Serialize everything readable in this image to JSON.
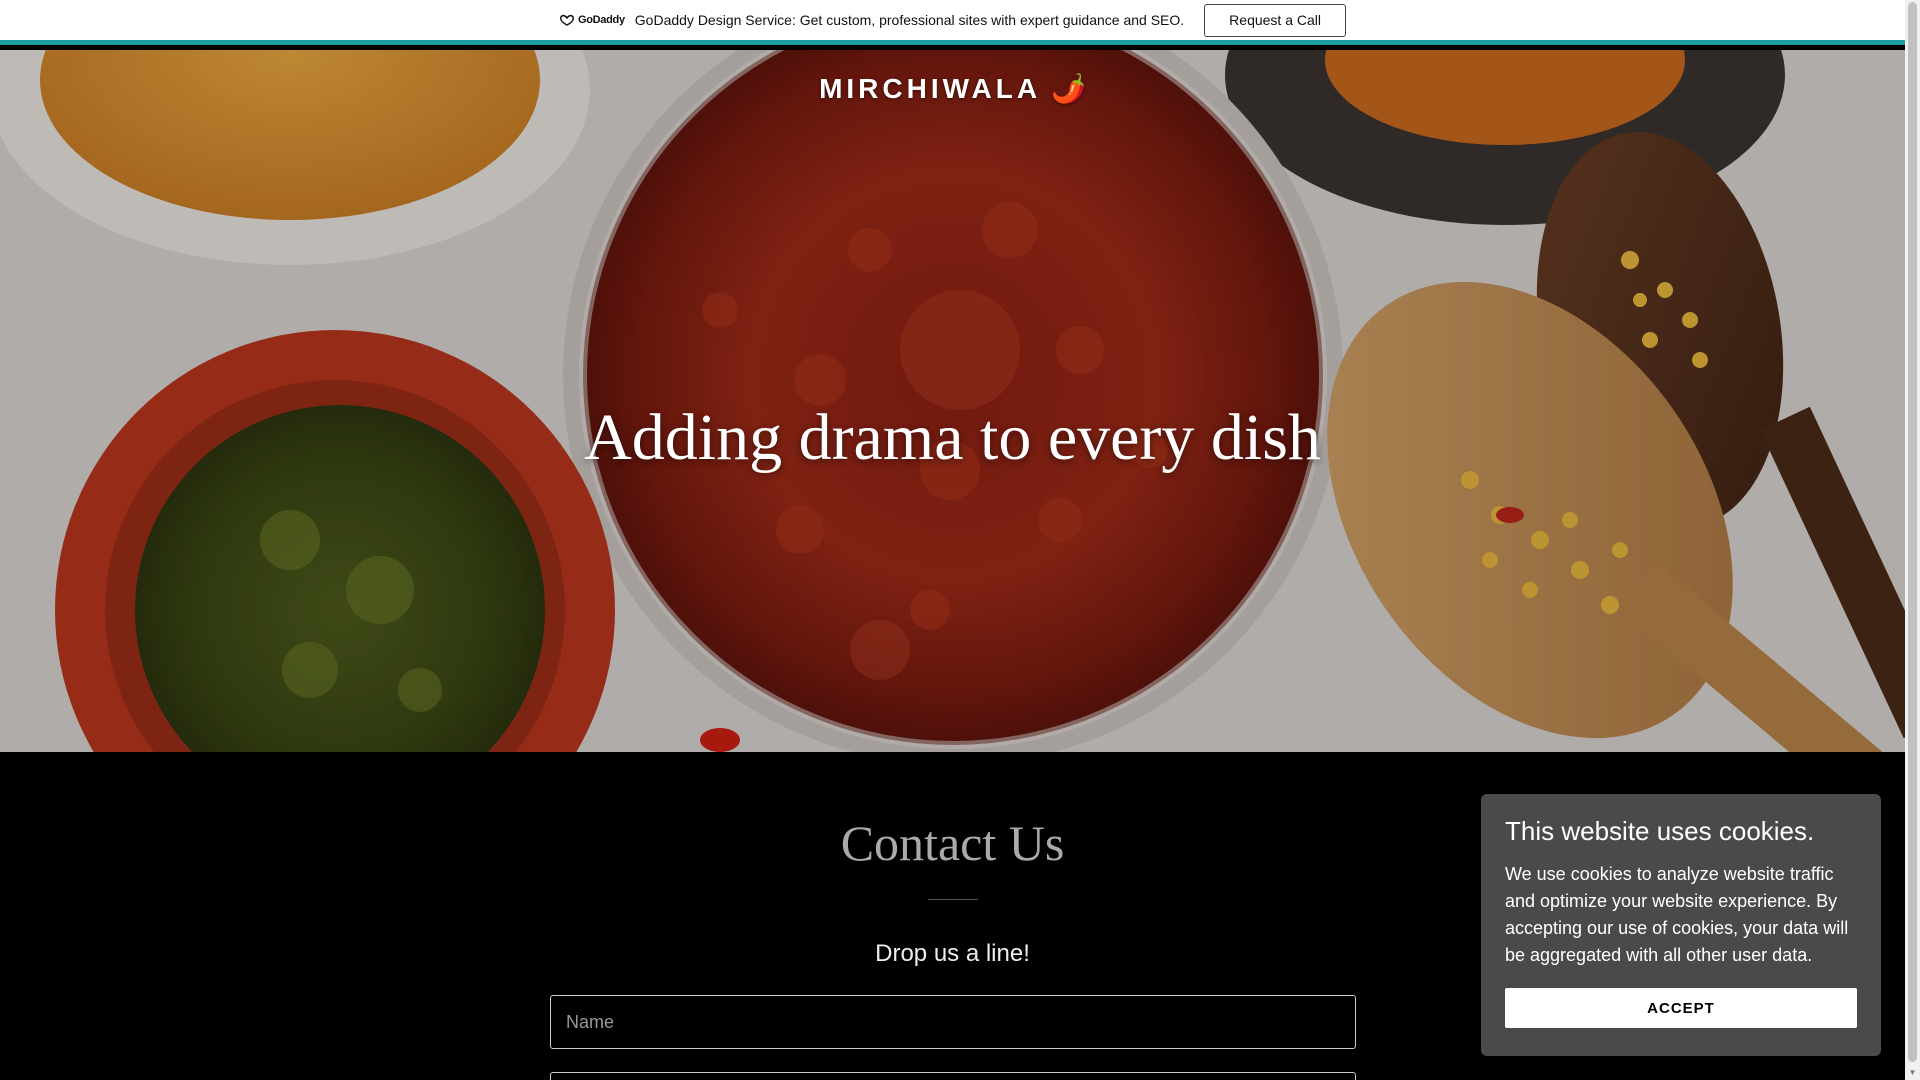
{
  "promo": {
    "logo_text": "GoDaddy",
    "message": "GoDaddy Design Service: Get custom, professional sites with expert guidance and SEO.",
    "button_label": "Request a Call",
    "accent_color": "#1a9ea0"
  },
  "hero": {
    "brand": "MIRCHIWALA",
    "brand_emoji": "🌶️",
    "headline": "Adding drama to every dish"
  },
  "contact": {
    "title": "Contact Us",
    "subtitle": "Drop us a line!",
    "name_placeholder": "Name"
  },
  "cookie": {
    "title": "This website uses cookies.",
    "body": "We use cookies to analyze website traffic and optimize your website experience. By accepting our use of cookies, your data will be aggregated with all other user data.",
    "accept_label": "ACCEPT"
  },
  "icons": {
    "godaddy_logo": "godaddy-logo-icon",
    "chili": "chili-pepper-icon"
  }
}
